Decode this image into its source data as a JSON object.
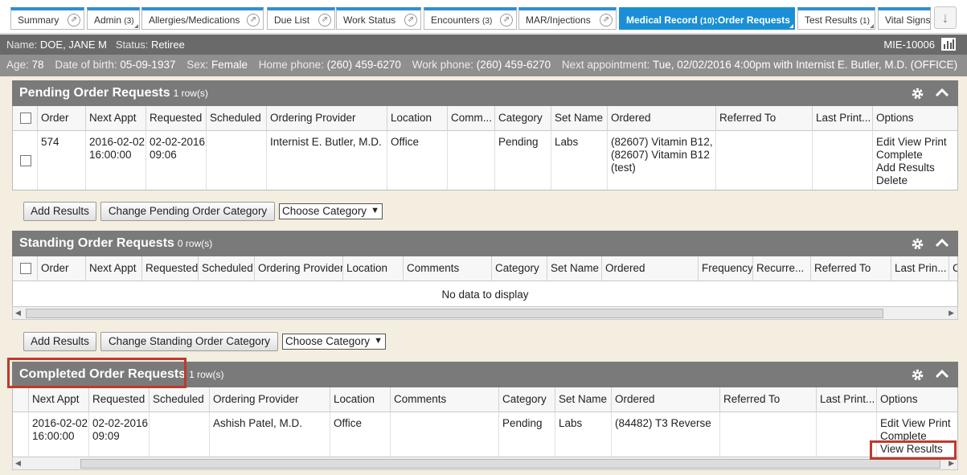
{
  "tabs": [
    {
      "label": "Summary",
      "count": "",
      "popout": true
    },
    {
      "label": "Admin",
      "count": "(3)",
      "popout": true
    },
    {
      "label": "Allergies/Medications",
      "count": "",
      "popout": true
    },
    {
      "label": "Due List",
      "count": "",
      "popout": true
    },
    {
      "label": "Work Status",
      "count": "",
      "popout": true
    },
    {
      "label": "Encounters",
      "count": "(3)",
      "popout": true
    },
    {
      "label": "MAR/Injections",
      "count": "",
      "popout": true
    },
    {
      "label": "Medical Record",
      "count": "(10)",
      "suffix": ":Order Requests",
      "popout": false
    },
    {
      "label": "Test Results",
      "count": "(1)",
      "popout": false
    },
    {
      "label": "Vital Signs",
      "count": "",
      "popout": false
    }
  ],
  "tab_scroll_icon": "arrow-down-icon",
  "patient": {
    "name_label": "Name:",
    "name": "DOE, JANE M",
    "status_label": "Status:",
    "status": "Retiree",
    "mrn": "MIE-10006",
    "age_label": "Age:",
    "age": "78",
    "dob_label": "Date of birth:",
    "dob": "05-09-1937",
    "sex_label": "Sex:",
    "sex": "Female",
    "home_label": "Home phone:",
    "home": "(260) 459-6270",
    "work_label": "Work phone:",
    "work": "(260) 459-6270",
    "appt_label": "Next appointment:",
    "appt": "Tue, 02/02/2016 4:00pm with Internist E. Butler, M.D. (OFFICE)"
  },
  "pending": {
    "title": "Pending Order Requests",
    "rows": "1 row(s)",
    "columns": [
      "Order",
      "Next Appt",
      "Requested",
      "Scheduled",
      "Ordering Provider",
      "Location",
      "Comm...",
      "Category",
      "Set Name",
      "Ordered",
      "Referred To",
      "Last Print...",
      "Options"
    ],
    "row": {
      "order": "574",
      "next_appt_1": "2016-02-02",
      "next_appt_2": "16:00:00",
      "requested_1": "02-02-2016",
      "requested_2": "09:06",
      "scheduled": "",
      "provider": "Internist E. Butler, M.D.",
      "location": "Office",
      "comments": "",
      "category": "Pending",
      "set_name": "Labs",
      "ordered_1": "(82607) Vitamin B12,",
      "ordered_2": "(82607) Vitamin B12",
      "ordered_3": "(test)",
      "referred": "",
      "last_print": "",
      "opt_edit": "Edit",
      "opt_view": "View",
      "opt_print": "Print",
      "opt_complete": "Complete",
      "opt_add": "Add Results",
      "opt_delete": "Delete"
    },
    "btn_add": "Add Results",
    "btn_change": "Change Pending Order Category",
    "select": "Choose Category"
  },
  "standing": {
    "title": "Standing Order Requests",
    "rows": "0 row(s)",
    "columns": [
      "Order",
      "Next Appt",
      "Requested",
      "Scheduled",
      "Ordering Provider",
      "Location",
      "Comments",
      "Category",
      "Set Name",
      "Ordered",
      "Frequency",
      "Recurre...",
      "Referred To",
      "Last Prin...",
      "C"
    ],
    "empty": "No data to display",
    "btn_add": "Add Results",
    "btn_change": "Change Standing Order Category",
    "select": "Choose Category"
  },
  "completed": {
    "title": "Completed Order Requests",
    "rows": "1 row(s)",
    "columns": [
      "Next Appt",
      "Requested",
      "Scheduled",
      "Ordering Provider",
      "Location",
      "Comments",
      "Category",
      "Set Name",
      "Ordered",
      "Referred To",
      "Last Print...",
      "Options"
    ],
    "row": {
      "next_appt_1": "2016-02-02",
      "next_appt_2": "16:00:00",
      "requested_1": "02-02-2016",
      "requested_2": "09:09",
      "scheduled": "",
      "provider": "Ashish Patel, M.D.",
      "location": "Office",
      "comments": "",
      "category": "Pending",
      "set_name": "Labs",
      "ordered": "(84482) T3 Reverse",
      "referred": "",
      "last_print": "",
      "opt_edit": "Edit",
      "opt_view": "View",
      "opt_print": "Print",
      "opt_complete": "Complete",
      "opt_view_results": "View Results"
    }
  },
  "colors": {
    "accent": "#1b8fd6",
    "panel_header": "#7a7a7a",
    "highlight": "#c0392b",
    "background": "#f3eedf"
  }
}
